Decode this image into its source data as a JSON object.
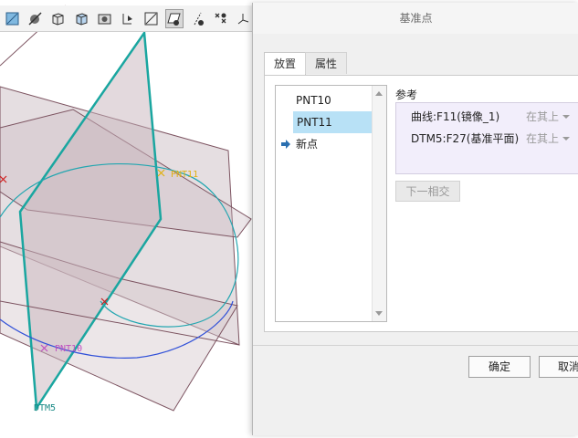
{
  "dialog": {
    "title": "基准点",
    "tabs": [
      {
        "label": "放置",
        "selected": true
      },
      {
        "label": "属性",
        "selected": false
      }
    ],
    "point_list": [
      "PNT10",
      "PNT11",
      "新点"
    ],
    "selected_point": "PNT11",
    "references_label": "参考",
    "references": [
      {
        "name": "曲线:F11(镜像_1)",
        "constraint": "在其上"
      },
      {
        "name": "DTM5:F27(基准平面)",
        "constraint": "在其上"
      }
    ],
    "next_intersection_label": "下一相交",
    "ok_label": "确定",
    "cancel_label": "取消"
  },
  "viewport": {
    "labels": {
      "pnt11": "PNT11",
      "pnt10": "PNT10",
      "dtm5": "DTM5"
    }
  },
  "toolbar": {
    "icons": [
      "datum-plane-icon",
      "datum-axis-icon",
      "cube-view-icon",
      "cube-display-icon",
      "saved-views-icon",
      "spin-center-icon",
      "plane-display-icon",
      "plane-tag-icon",
      "axis-display-icon",
      "point-display-icon",
      "csys-display-icon"
    ]
  },
  "colors": {
    "plane_fill": "#cfc2c8",
    "plane_edge": "#7c5360",
    "dtm5_edge": "#1aa6a0",
    "curve": "#22a6b0",
    "curve_blue": "#3050d8",
    "pnt11": "#e0b010",
    "pnt10": "#c050c0",
    "selection": "#b8e1f6",
    "reference_box": "#f2eefb"
  }
}
